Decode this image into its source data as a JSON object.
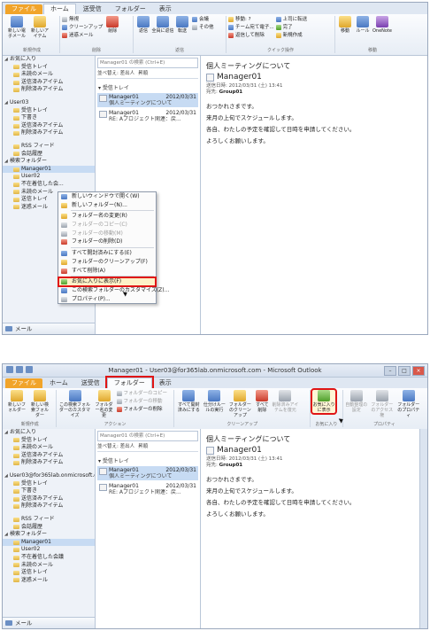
{
  "window": {
    "title": "Manager01 - User03@for365lab.onmicrosoft.com - Microsoft Outlook"
  },
  "tabs": {
    "file": "ファイル",
    "home": "ホーム",
    "sendrecv": "送受信",
    "folder": "フォルダー",
    "view": "表示"
  },
  "ribbon_home": {
    "new_email": "新しい電子メール",
    "new_items": "新しいアイテム",
    "ignore": "無視",
    "cleanup": "クリーンアップ",
    "junk": "迷惑メール",
    "delete": "削除",
    "reply": "返信",
    "reply_all": "全員に返信",
    "forward": "転送",
    "meeting": "会議",
    "more": "その他",
    "move_to": "移動: ?",
    "to_manager": "チーム宛て電子...",
    "reply_delete": "返信して削除",
    "to_boss": "上司に転送",
    "done": "完了",
    "create_new": "新規作成",
    "move": "移動",
    "rules": "ルール",
    "onenote": "OneNote",
    "g_new": "新規作成",
    "g_delete": "削除",
    "g_respond": "返信",
    "g_quick": "クイック操作",
    "g_move": "移動"
  },
  "ribbon_folder": {
    "new_folder": "新しいフォルダー",
    "new_search": "新しい検索フォルダー",
    "customize": "この検索フォルダーのカスタマイズ",
    "rename": "フォルダー名の変更",
    "copy_folder": "フォルダーのコピー",
    "move_folder": "フォルダーの移動",
    "delete_folder": "フォルダーの削除",
    "mark_all_read": "すべて開封済みにする",
    "run_rules": "仕分けルールの実行",
    "cleanup_folder": "フォルダーのクリーンアップ",
    "delete_all": "すべて削除",
    "recover": "削除済みアイテムを復元",
    "show_favorites": "お気に入りに表示",
    "autoarchive": "自動整理の設定",
    "permissions": "フォルダーのアクセス権",
    "properties": "フォルダーのプロパティ",
    "g_new": "新規作成",
    "g_actions": "アクション",
    "g_cleanup": "クリーンアップ",
    "g_favorites": "お気に入り",
    "g_props": "プロパティ"
  },
  "nav1": [
    {
      "label": "お気に入り",
      "type": "header"
    },
    {
      "label": "受信トレイ",
      "type": "folder"
    },
    {
      "label": "未読のメール",
      "type": "folder"
    },
    {
      "label": "送信済みアイテム",
      "type": "folder"
    },
    {
      "label": "削除済みアイテム",
      "type": "folder"
    },
    {
      "label": "",
      "type": "gap"
    },
    {
      "label": "User03",
      "type": "header"
    },
    {
      "label": "受信トレイ",
      "type": "folder"
    },
    {
      "label": "下書き",
      "type": "folder"
    },
    {
      "label": "送信済みアイテム",
      "type": "folder"
    },
    {
      "label": "削除済みアイテム",
      "type": "folder"
    },
    {
      "label": "",
      "type": "gap"
    },
    {
      "label": "RSS フィード",
      "type": "folder"
    },
    {
      "label": "会話履歴",
      "type": "folder"
    },
    {
      "label": "検索フォルダー",
      "type": "header"
    },
    {
      "label": "Manager01",
      "type": "selected"
    },
    {
      "label": "User02",
      "type": "folder"
    },
    {
      "label": "不在着信した会...",
      "type": "folder"
    },
    {
      "label": "未読のメール",
      "type": "folder"
    },
    {
      "label": "送信トレイ",
      "type": "folder"
    },
    {
      "label": "迷惑メール",
      "type": "folder"
    }
  ],
  "nav2": [
    {
      "label": "お気に入り",
      "type": "header"
    },
    {
      "label": "受信トレイ",
      "type": "folder"
    },
    {
      "label": "未読のメール",
      "type": "folder"
    },
    {
      "label": "送信済みアイテム",
      "type": "folder"
    },
    {
      "label": "削除済みアイテム",
      "type": "folder"
    },
    {
      "label": "",
      "type": "gap"
    },
    {
      "label": "User03@for365lab.onmicrosoft.co",
      "type": "header"
    },
    {
      "label": "受信トレイ",
      "type": "folder"
    },
    {
      "label": "下書き",
      "type": "folder"
    },
    {
      "label": "送信済みアイテム",
      "type": "folder"
    },
    {
      "label": "削除済みアイテム",
      "type": "folder"
    },
    {
      "label": "",
      "type": "gap"
    },
    {
      "label": "RSS フィード",
      "type": "folder"
    },
    {
      "label": "会話履歴",
      "type": "folder"
    },
    {
      "label": "検索フォルダー",
      "type": "header"
    },
    {
      "label": "Manager01",
      "type": "selected"
    },
    {
      "label": "User02",
      "type": "folder"
    },
    {
      "label": "不在着信した会議",
      "type": "folder"
    },
    {
      "label": "未読のメール",
      "type": "folder"
    },
    {
      "label": "送信トレイ",
      "type": "folder"
    },
    {
      "label": "迷惑メール",
      "type": "folder"
    }
  ],
  "nav_bottom": "メール",
  "list": {
    "search_placeholder": "Manager01 の検索 (Ctrl+E)",
    "sort_label": "並べ替え: 差出人",
    "sort_dir": "昇順",
    "group": "受信トレイ",
    "messages": [
      {
        "from": "Manager01",
        "date": "2012/03/31",
        "subject": "個人ミーティングについて"
      },
      {
        "from": "Manager01",
        "date": "2012/03/31",
        "subject": "RE: Aプロジェクト関連：戻..."
      }
    ]
  },
  "reading": {
    "subject": "個人ミーティングについて",
    "from": "Manager01",
    "sent_label": "送信日時:",
    "sent_value": "2012/03/31 (土) 13:41",
    "to_label": "宛先:",
    "to_value": "Group01",
    "body": [
      "おつかれさまです。",
      "来月の上旬でスケジュールします。",
      "各自、わたしの予定を確認して日時を申請してください。",
      "よろしくお願いします。"
    ]
  },
  "context_menu": [
    {
      "label": "新しいウィンドウで開く(W)",
      "state": "normal",
      "icon": "window"
    },
    {
      "label": "新しいフォルダー(N)...",
      "state": "normal",
      "icon": "folder"
    },
    {
      "sep": true
    },
    {
      "label": "フォルダー名の変更(R)",
      "state": "normal",
      "icon": "rename"
    },
    {
      "label": "フォルダーのコピー(C)",
      "state": "disabled",
      "icon": "copy"
    },
    {
      "label": "フォルダーの移動(M)",
      "state": "disabled",
      "icon": "move"
    },
    {
      "label": "フォルダーの削除(D)",
      "state": "normal",
      "icon": "delete"
    },
    {
      "sep": true
    },
    {
      "label": "すべて開封済みにする(E)",
      "state": "normal",
      "icon": "read"
    },
    {
      "label": "フォルダーのクリーンアップ(F)",
      "state": "normal",
      "icon": "cleanup"
    },
    {
      "label": "すべて削除(A)",
      "state": "normal",
      "icon": "deleteall"
    },
    {
      "sep": true
    },
    {
      "label": "お気に入りに表示(F)",
      "state": "highlight",
      "icon": "favorite"
    },
    {
      "label": "この検索フォルダーのカスタマイズ(Z)...",
      "state": "normal",
      "icon": "customize"
    },
    {
      "label": "プロパティ(P)...",
      "state": "normal",
      "icon": "properties"
    }
  ]
}
